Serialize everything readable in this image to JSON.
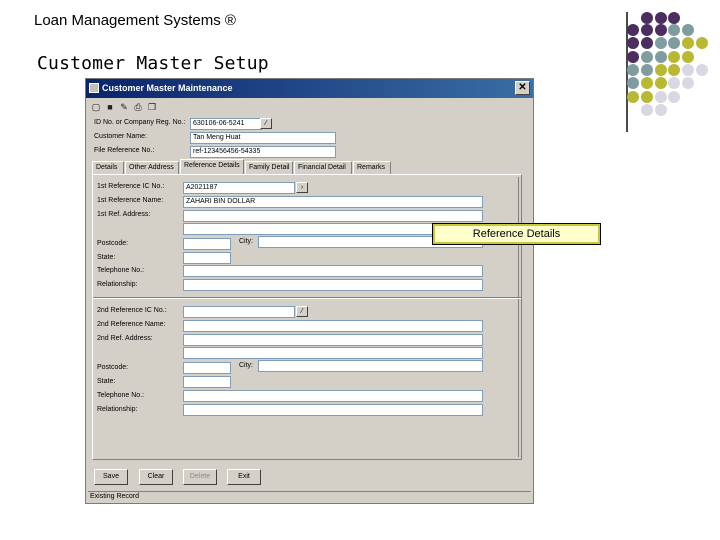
{
  "slide": {
    "title": "Loan Management Systems ®",
    "subtitle": "Customer Master Setup",
    "callout": "Reference Details"
  },
  "window": {
    "title": "Customer Master Maintenance",
    "close_glyph": "✕",
    "toolbar_icons": [
      "new-icon",
      "save-icon",
      "edit-icon",
      "print-icon",
      "copy-icon"
    ]
  },
  "header": {
    "id_label": "ID No. or Company Reg. No.:",
    "id_value": "630106-06-5241",
    "name_label": "Customer Name:",
    "name_value": "Tan Meng Huat",
    "file_label": "File Reference No.:",
    "file_value": "ref-123456456-54335"
  },
  "tabs": [
    {
      "label": "Details"
    },
    {
      "label": "Other Address"
    },
    {
      "label": "Reference Details"
    },
    {
      "label": "Family Detail"
    },
    {
      "label": "Financial Detail"
    },
    {
      "label": "Remarks"
    }
  ],
  "ref1": {
    "id_label": "1st Reference IC No.:",
    "id_value": "A2021187",
    "name_label": "1st Reference Name:",
    "name_value": "ZAHARI BIN DOLLAR",
    "address_label": "1st Ref. Address:",
    "postcode_label": "Postcode:",
    "city_label": "City:",
    "state_label": "State:",
    "phone_label": "Telephone No.:",
    "relationship_label": "Relationship:"
  },
  "ref2": {
    "id_label": "2nd Reference IC No.:",
    "name_label": "2nd Reference Name:",
    "address_label": "2nd Ref. Address:",
    "postcode_label": "Postcode:",
    "city_label": "City:",
    "state_label": "State:",
    "phone_label": "Telephone No.:",
    "relationship_label": "Relationship:"
  },
  "buttons": {
    "save": "Save",
    "clear": "Clear",
    "delete": "Delete",
    "exit": "Exit"
  },
  "status": "Existing Record",
  "colors": {
    "purple": "#4b2e5f",
    "gray": "#7f9d9f",
    "olive": "#b9b832",
    "light": "#d9d8e2"
  }
}
